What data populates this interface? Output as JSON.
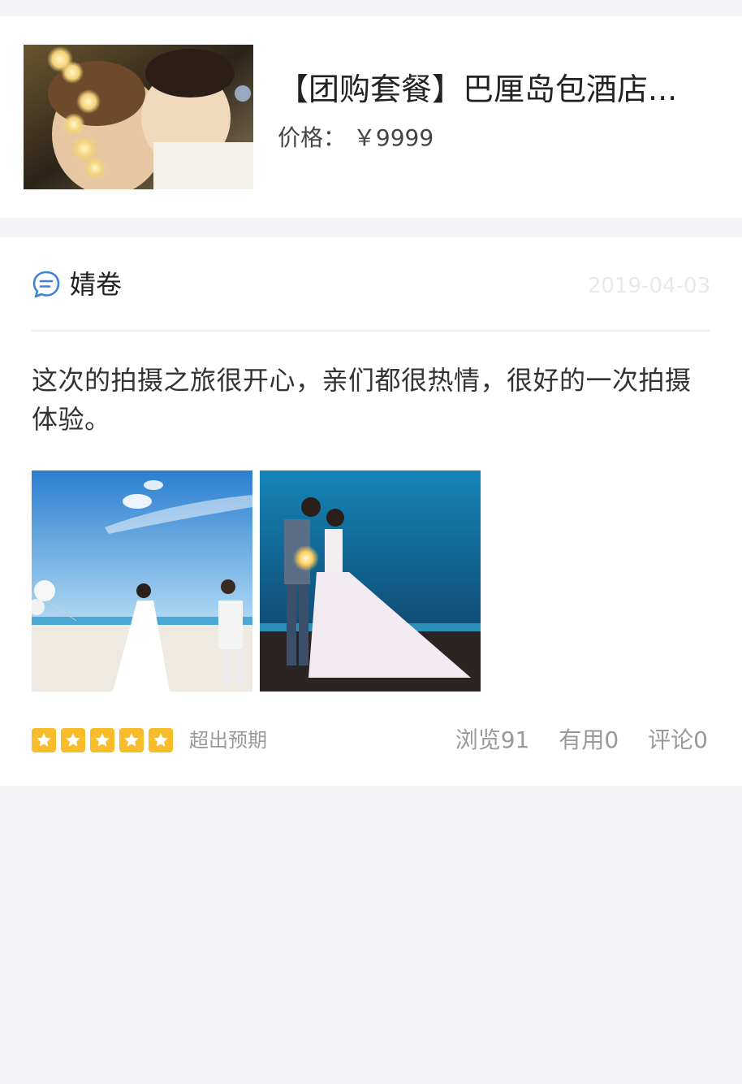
{
  "product": {
    "title": "【团购套餐】巴厘岛包酒店...",
    "price_label": "价格：",
    "price": "￥9999",
    "thumbnail_desc": "couple-kiss-photo"
  },
  "review": {
    "username": "婧卷",
    "date": "2019-04-03",
    "body": "这次的拍摄之旅很开心，亲们都很热情，很好的一次拍摄体验。",
    "photos": [
      "beach-wedding-photo",
      "night-sparkler-wedding-photo"
    ],
    "rating": 5,
    "rating_label": "超出预期",
    "stats": {
      "views": "浏览91",
      "useful": "有用0",
      "comments": "评论0"
    }
  },
  "colors": {
    "star": "#f7bd2b",
    "icon_blue": "#3d83d8",
    "page_bg": "#f4f4f6"
  }
}
